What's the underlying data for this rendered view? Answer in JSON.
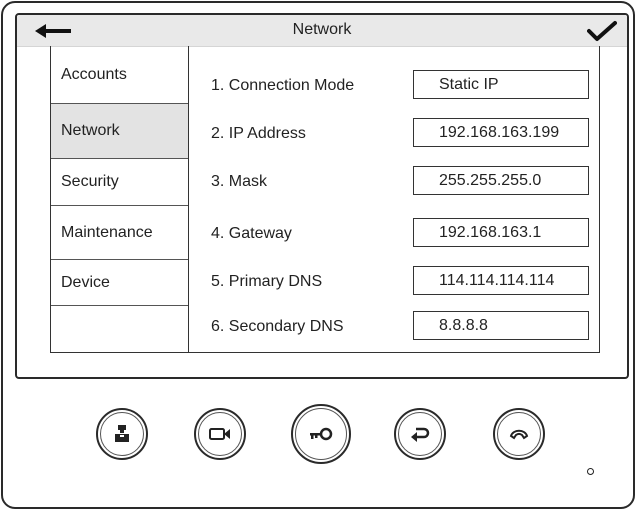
{
  "header": {
    "title": "Network"
  },
  "menu": {
    "items": [
      {
        "label": "Accounts"
      },
      {
        "label": "Network"
      },
      {
        "label": "Security"
      },
      {
        "label": "Maintenance"
      },
      {
        "label": "Device"
      }
    ],
    "active": "Network"
  },
  "settings": [
    {
      "label": "1. Connection Mode",
      "value": "Static IP"
    },
    {
      "label": "2. IP Address",
      "value": "192.168.163.199"
    },
    {
      "label": "3. Mask",
      "value": "255.255.255.0"
    },
    {
      "label": "4. Gateway",
      "value": "192.168.163.1"
    },
    {
      "label": "5. Primary DNS",
      "value": "114.114.114.114"
    },
    {
      "label": "6. Secondary DNS",
      "value": "8.8.8.8"
    }
  ],
  "hardware_buttons": [
    {
      "icon": "monitor-person-icon"
    },
    {
      "icon": "camera-icon"
    },
    {
      "icon": "key-icon"
    },
    {
      "icon": "return-icon"
    },
    {
      "icon": "hang-up-icon"
    }
  ]
}
